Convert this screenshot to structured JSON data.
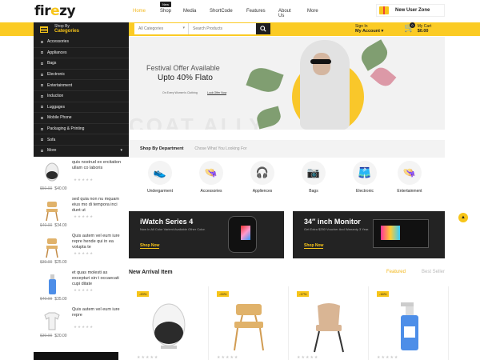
{
  "brand": {
    "logo_main": "fir",
    "logo_accent": "e",
    "logo_tail": "zy"
  },
  "nav": {
    "items": [
      {
        "label": "Home",
        "active": true
      },
      {
        "label": "Shop",
        "badge": "New"
      },
      {
        "label": "Media"
      },
      {
        "label": "ShortCode"
      },
      {
        "label": "Features"
      },
      {
        "label": "About Us"
      },
      {
        "label": "More"
      }
    ]
  },
  "promo": {
    "label": "New User Zone",
    "icon": "gift-icon"
  },
  "category_button": {
    "line1": "Shop By",
    "line2": "Categories"
  },
  "search": {
    "category": "All Categories",
    "placeholder": "Search Products"
  },
  "account": {
    "line1": "Sign In",
    "line2": "My Account ▾"
  },
  "cart": {
    "line1": "My Cart",
    "line2": "$0.00",
    "count": "0"
  },
  "categories": [
    "Accessories",
    "Appliances",
    "Bags",
    "Electronic",
    "Entertainment",
    "Induction",
    "Luggages",
    "Mobile Phone",
    "Packaging & Printing",
    "Sofa",
    "More"
  ],
  "hero": {
    "tag": "Festival Offer Available",
    "headline": "Upto 40% Flato",
    "sub": "On Every Women's Clothing",
    "cta": "Look Offer Now",
    "ghost": "COAT  ALLY"
  },
  "departments": {
    "title": "Shop By Department",
    "subtitle": "Chose What You Looking For",
    "items": [
      {
        "label": "Undergarment",
        "icon": "sneaker-icon",
        "glyph": "👟"
      },
      {
        "label": "Accessories",
        "icon": "hat-icon",
        "glyph": "👒"
      },
      {
        "label": "Appliences",
        "icon": "headphones-icon",
        "glyph": "🎧"
      },
      {
        "label": "Bags",
        "icon": "camera-icon",
        "glyph": "📷"
      },
      {
        "label": "Electronic",
        "icon": "shorts-icon",
        "glyph": "🩳"
      },
      {
        "label": "Entertainment",
        "icon": "hat-icon",
        "glyph": "👒"
      }
    ]
  },
  "banners": [
    {
      "title": "iWatch Series 4",
      "desc": "Now In All Color Varient Available Other Color.",
      "cta": "Shop Now"
    },
    {
      "title": "34″ inch Monitor",
      "desc": "Get Extra $250 Voucher And Warranty 3 Year.",
      "cta": "Shop Now"
    }
  ],
  "new_arrival": {
    "title": "New Arrival Item",
    "tabs": [
      {
        "label": "Featured",
        "active": true
      },
      {
        "label": "Best Seller"
      }
    ],
    "products": [
      {
        "discount": "-20%",
        "kind": "speaker"
      },
      {
        "discount": "-24%",
        "kind": "chair-wood"
      },
      {
        "discount": "-17%",
        "kind": "chair-leather"
      },
      {
        "discount": "-16%",
        "kind": "spray-bottle"
      }
    ]
  },
  "side_products": [
    {
      "title": "quis nostrud ex ercitation ullam co laboris",
      "old": "$50.00",
      "price": "$40.00",
      "kind": "speaker"
    },
    {
      "title": "sed quia non nu mquam eius mo di tempora inci dunt ut",
      "old": "$40.00",
      "price": "$34.00",
      "kind": "chair"
    },
    {
      "title": "Quis autem vel eum iure repre hende qui in ea volupta te",
      "old": "$30.00",
      "price": "$25.00",
      "kind": "chair"
    },
    {
      "title": "et quas molesti as excepturi sin t occaecati cupi ditate",
      "old": "$40.00",
      "price": "$35.00",
      "kind": "bottle"
    },
    {
      "title": "Quis autem vel eum iure repre",
      "old": "$30.00",
      "price": "$20.00",
      "kind": "shirt"
    }
  ],
  "colors": {
    "accent": "#fbcb24",
    "dark": "#1e1e1e"
  }
}
